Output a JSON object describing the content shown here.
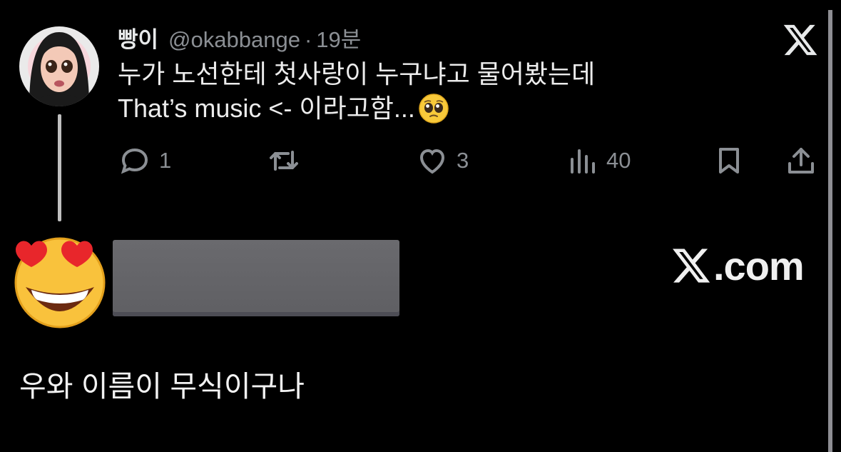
{
  "tweet": {
    "display_name": "빵이",
    "handle": "@okabbange",
    "separator": "·",
    "time": "19분",
    "text_line_1": "누가 노선한테 첫사랑이 누구냐고 물어봤는데",
    "text_line_2": "That’s music <- 이라고함...",
    "inline_emoji": "pleading-face"
  },
  "actions": {
    "replies": "1",
    "likes": "3",
    "views": "40"
  },
  "watermark": {
    "label": ".com"
  },
  "reply": {
    "reaction_emoji": "heart-eyes-face",
    "text": "우와 이름이 무식이구나"
  },
  "colors": {
    "background": "#000000",
    "text": "#e7e9ea",
    "muted": "#8b8f94",
    "redaction": "#646468"
  }
}
